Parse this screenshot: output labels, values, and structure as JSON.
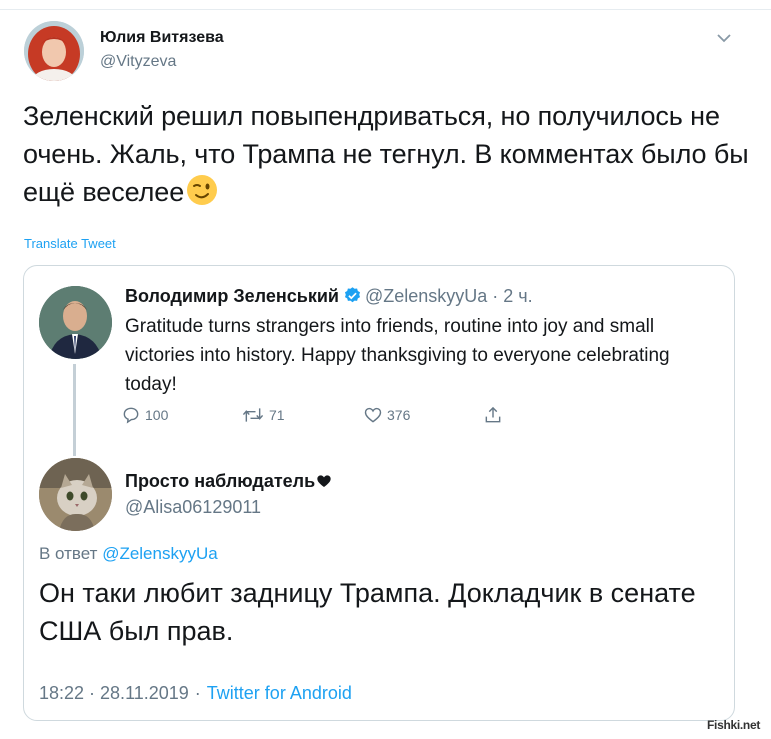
{
  "tweet": {
    "author_name": "Юлия Витязева",
    "author_handle": "@Vityzeva",
    "text": "Зеленский решил повыпендриваться, но получилось не очень. Жаль, что Трампа не тегнул. В комментах было бы ещё веселее",
    "emoji": "wink-emoji",
    "translate_label": "Translate Tweet",
    "menu_icon": "chevron-down-icon"
  },
  "embedded": {
    "original": {
      "name": "Володимир Зеленський",
      "handle": "@ZelenskyyUa",
      "time": "2 ч.",
      "verified": true,
      "text": "Gratitude turns strangers into friends, routine into joy and small victories into history. Happy thanksgiving to everyone celebrating today!",
      "actions": {
        "reply_count": "100",
        "retweet_count": "71",
        "like_count": "376"
      }
    },
    "reply": {
      "name": "Просто наблюдатель",
      "handle": "@Alisa06129011",
      "reply_to_prefix": "В ответ",
      "reply_to_handle": "@ZelenskyyUa",
      "text": "Он таки любит задницу Трампа. Докладчик в сенате США был прав.",
      "timestamp": "18:22 · 28.11.2019",
      "source": "Twitter for Android"
    }
  },
  "watermark": "Fishki.net",
  "colors": {
    "link": "#1da1f2",
    "secondary_text": "#657786",
    "primary_text": "#14171a",
    "border": "#cfd9de"
  }
}
